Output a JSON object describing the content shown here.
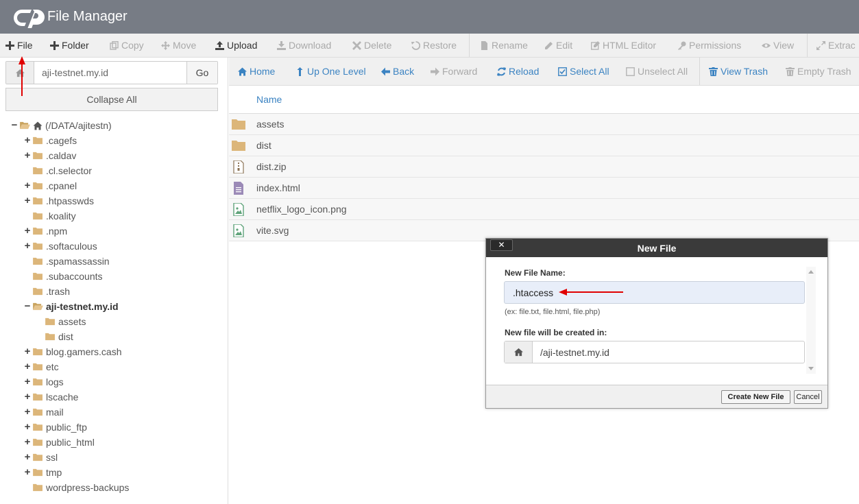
{
  "app": {
    "title": "File Manager"
  },
  "toolbar": [
    {
      "label": "File",
      "icon": "plus-icon",
      "disabled": false
    },
    {
      "label": "Folder",
      "icon": "plus-icon",
      "disabled": false
    },
    {
      "label": "Copy",
      "icon": "copy-icon",
      "disabled": true
    },
    {
      "label": "Move",
      "icon": "move-icon",
      "disabled": true
    },
    {
      "label": "Upload",
      "icon": "upload-icon",
      "disabled": false
    },
    {
      "label": "Download",
      "icon": "download-icon",
      "disabled": true
    },
    {
      "label": "Delete",
      "icon": "delete-icon",
      "disabled": true
    },
    {
      "label": "Restore",
      "icon": "restore-icon",
      "disabled": true
    },
    {
      "label": "Rename",
      "icon": "rename-icon",
      "disabled": true
    },
    {
      "label": "Edit",
      "icon": "pencil-icon",
      "disabled": true
    },
    {
      "label": "HTML Editor",
      "icon": "html-editor-icon",
      "disabled": true
    },
    {
      "label": "Permissions",
      "icon": "key-icon",
      "disabled": true
    },
    {
      "label": "View",
      "icon": "eye-icon",
      "disabled": true
    },
    {
      "label": "Extrac",
      "icon": "expand-icon",
      "disabled": true
    }
  ],
  "sidebar": {
    "path_value": "aji-testnet.my.id",
    "go_label": "Go",
    "collapse_label": "Collapse All",
    "tree": [
      {
        "label": "(/DATA/ajitestn)",
        "toggle": "−",
        "open": true,
        "home": true,
        "level": 0
      },
      {
        "label": ".cagefs",
        "toggle": "+",
        "level": 1
      },
      {
        "label": ".caldav",
        "toggle": "+",
        "level": 1
      },
      {
        "label": ".cl.selector",
        "toggle": "",
        "level": 1
      },
      {
        "label": ".cpanel",
        "toggle": "+",
        "level": 1
      },
      {
        "label": ".htpasswds",
        "toggle": "+",
        "level": 1
      },
      {
        "label": ".koality",
        "toggle": "",
        "level": 1
      },
      {
        "label": ".npm",
        "toggle": "+",
        "level": 1
      },
      {
        "label": ".softaculous",
        "toggle": "+",
        "level": 1
      },
      {
        "label": ".spamassassin",
        "toggle": "",
        "level": 1
      },
      {
        "label": ".subaccounts",
        "toggle": "",
        "level": 1
      },
      {
        "label": ".trash",
        "toggle": "",
        "level": 1
      },
      {
        "label": "aji-testnet.my.id",
        "toggle": "−",
        "open": true,
        "bold": true,
        "level": 1
      },
      {
        "label": "assets",
        "toggle": "",
        "level": 2
      },
      {
        "label": "dist",
        "toggle": "",
        "level": 2
      },
      {
        "label": "blog.gamers.cash",
        "toggle": "+",
        "level": 1
      },
      {
        "label": "etc",
        "toggle": "+",
        "level": 1
      },
      {
        "label": "logs",
        "toggle": "+",
        "level": 1
      },
      {
        "label": "lscache",
        "toggle": "+",
        "level": 1
      },
      {
        "label": "mail",
        "toggle": "+",
        "level": 1
      },
      {
        "label": "public_ftp",
        "toggle": "+",
        "level": 1
      },
      {
        "label": "public_html",
        "toggle": "+",
        "level": 1
      },
      {
        "label": "ssl",
        "toggle": "+",
        "level": 1
      },
      {
        "label": "tmp",
        "toggle": "+",
        "level": 1
      },
      {
        "label": "wordpress-backups",
        "toggle": "",
        "level": 1
      }
    ]
  },
  "navbar": [
    {
      "label": "Home",
      "icon": "home-icon",
      "disabled": false
    },
    {
      "label": "Up One Level",
      "icon": "level-up-icon",
      "disabled": false
    },
    {
      "label": "Back",
      "icon": "arrow-left-icon",
      "disabled": false
    },
    {
      "label": "Forward",
      "icon": "arrow-right-icon",
      "disabled": true
    },
    {
      "label": "Reload",
      "icon": "reload-icon",
      "disabled": false
    },
    {
      "label": "Select All",
      "icon": "checkbox-checked-icon",
      "disabled": false
    },
    {
      "label": "Unselect All",
      "icon": "checkbox-empty-icon",
      "disabled": true
    },
    {
      "label": "View Trash",
      "icon": "trash-icon",
      "disabled": false
    },
    {
      "label": "Empty Trash",
      "icon": "trash-icon",
      "disabled": true
    }
  ],
  "files": {
    "column_name": "Name",
    "rows": [
      {
        "name": "assets",
        "type": "folder"
      },
      {
        "name": "dist",
        "type": "folder"
      },
      {
        "name": "dist.zip",
        "type": "zip"
      },
      {
        "name": "index.html",
        "type": "text"
      },
      {
        "name": "netflix_logo_icon.png",
        "type": "image"
      },
      {
        "name": "vite.svg",
        "type": "image"
      }
    ]
  },
  "dialog": {
    "title": "New File",
    "close_label": "✕",
    "name_label": "New File Name:",
    "name_value": ".htaccess",
    "hint": "(ex: file.txt, file.html, file.php)",
    "location_label": "New file will be created in:",
    "location_value": "/aji-testnet.my.id",
    "create_label": "Create New File",
    "cancel_label": "Cancel"
  },
  "colors": {
    "topbar": "#777c85",
    "link_blue": "#3b83c2",
    "folder": "#dcb67a",
    "annotation_red": "#e00000"
  }
}
